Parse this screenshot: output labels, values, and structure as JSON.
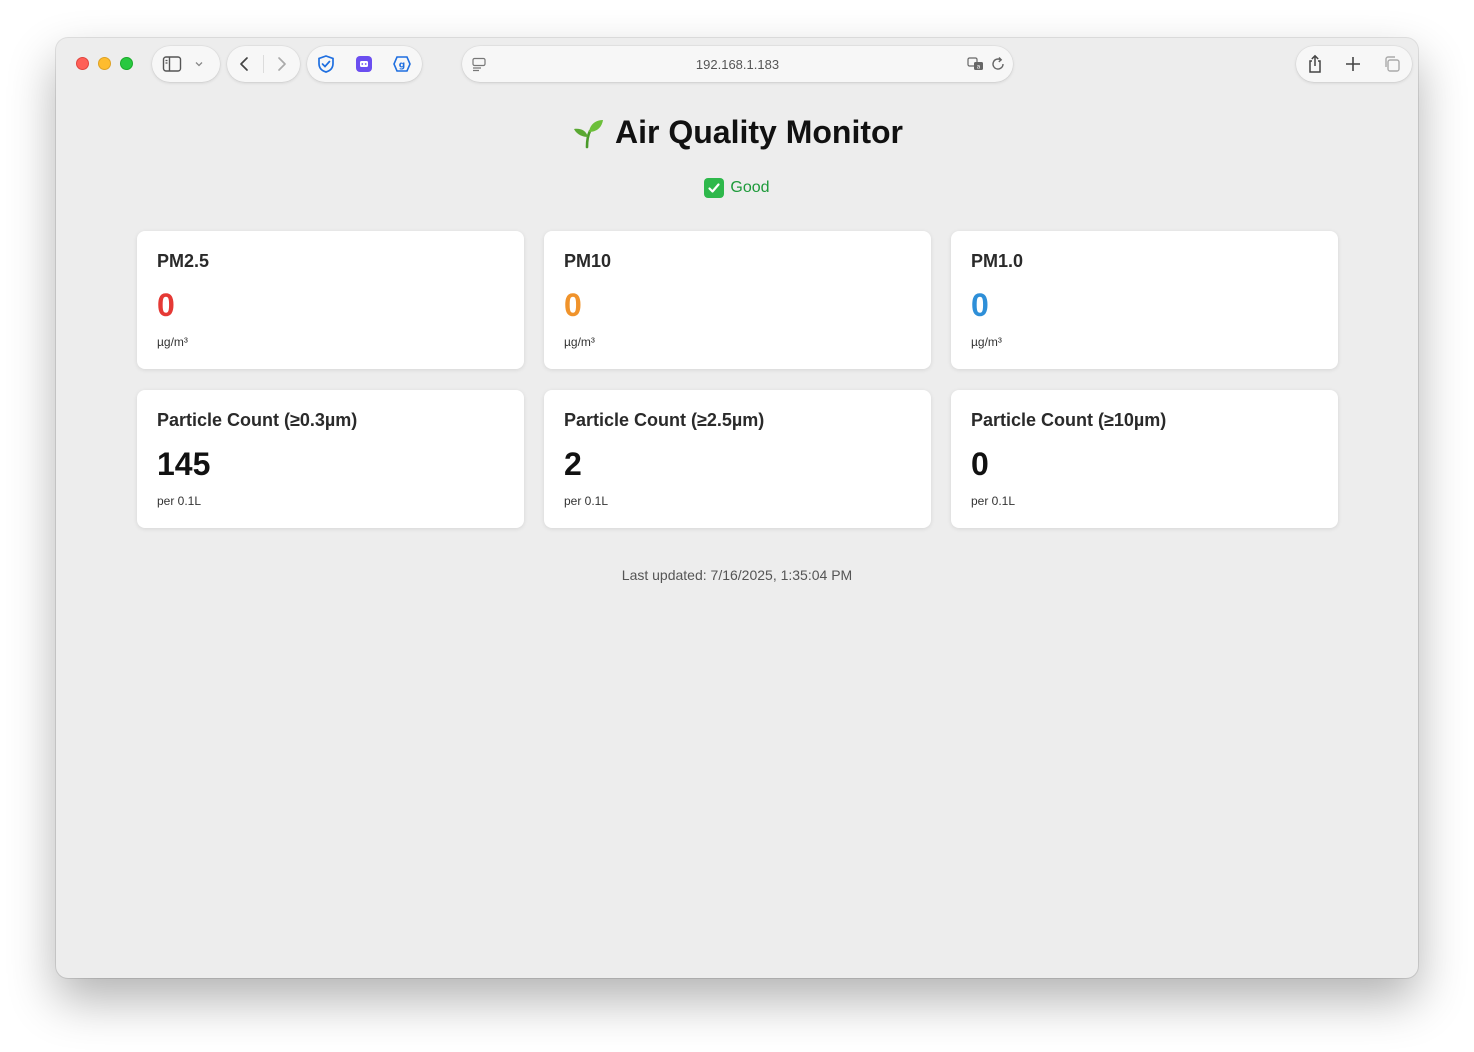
{
  "browser": {
    "url": "192.168.1.183"
  },
  "page": {
    "title": "Air Quality Monitor",
    "title_icon": "seedling-icon",
    "status": {
      "text": "Good",
      "icon": "check-mark-icon",
      "color": "#1d9a3a"
    },
    "cards": [
      {
        "label": "PM2.5",
        "value": "0",
        "unit": "µg/m³",
        "color": "#e53935"
      },
      {
        "label": "PM10",
        "value": "0",
        "unit": "µg/m³",
        "color": "#f0932b"
      },
      {
        "label": "PM1.0",
        "value": "0",
        "unit": "µg/m³",
        "color": "#2e8fd8"
      },
      {
        "label": "Particle Count (≥0.3µm)",
        "value": "145",
        "unit": "per 0.1L",
        "color": "#111111"
      },
      {
        "label": "Particle Count (≥2.5µm)",
        "value": "2",
        "unit": "per 0.1L",
        "color": "#111111"
      },
      {
        "label": "Particle Count (≥10µm)",
        "value": "0",
        "unit": "per 0.1L",
        "color": "#111111"
      }
    ],
    "last_updated": "Last updated: 7/16/2025, 1:35:04 PM"
  }
}
